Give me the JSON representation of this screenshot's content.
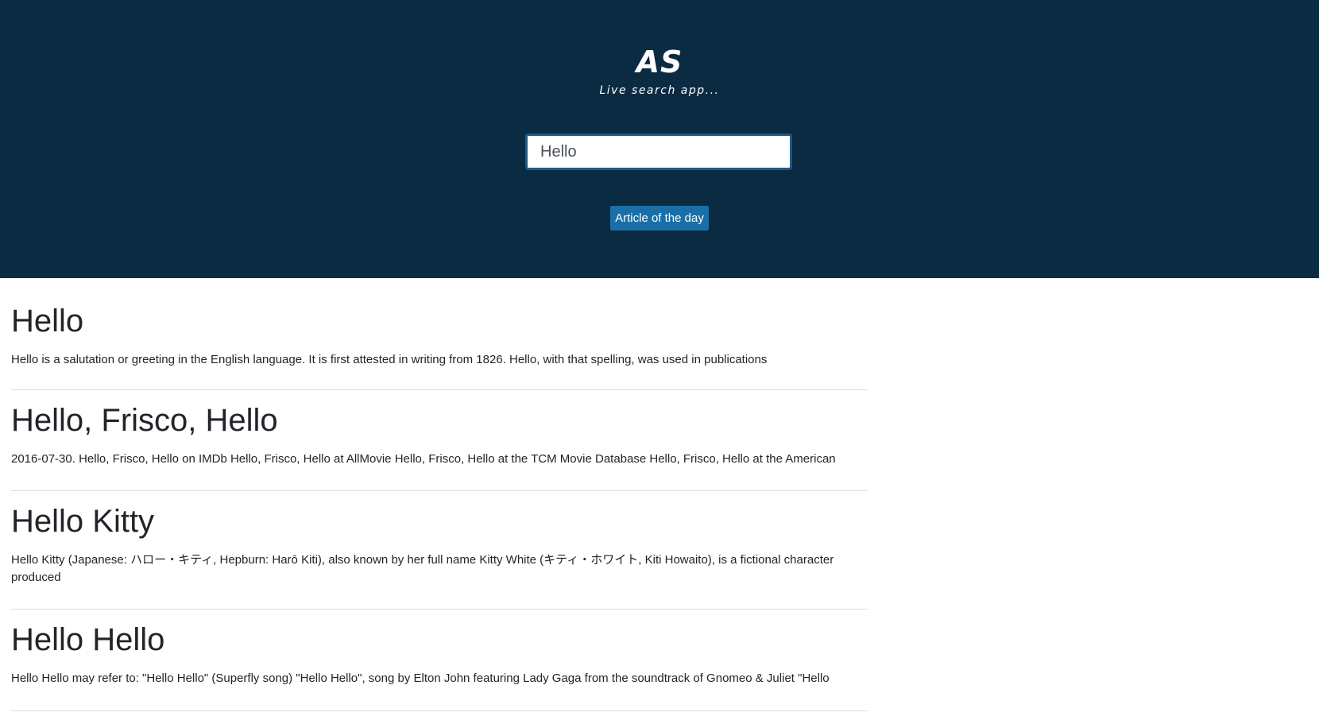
{
  "header": {
    "logo_text": "AS",
    "tagline": "Live search app...",
    "search_value": "Hello",
    "button_label": "Article of the day",
    "background_color": "#0b2b42",
    "button_color": "#1a6fa8"
  },
  "results": [
    {
      "title": "Hello",
      "snippet": "Hello is a salutation or greeting in the English language. It is first attested in writing from 1826. Hello, with that spelling, was used in publications"
    },
    {
      "title": "Hello, Frisco, Hello",
      "snippet": "2016-07-30. Hello, Frisco, Hello on IMDb  Hello, Frisco, Hello at AllMovie Hello, Frisco, Hello at the TCM Movie Database Hello, Frisco, Hello at the American"
    },
    {
      "title": "Hello Kitty",
      "snippet": "Hello Kitty (Japanese: ハロー・キティ, Hepburn: Harō Kiti), also known by her full name Kitty White (キティ・ホワイト, Kiti Howaito), is a fictional character produced"
    },
    {
      "title": "Hello Hello",
      "snippet": "Hello Hello may refer to: \"Hello Hello\" (Superfly song) \"Hello Hello\", song by Elton John featuring Lady Gaga from the soundtrack of Gnomeo & Juliet \"Hello"
    }
  ]
}
